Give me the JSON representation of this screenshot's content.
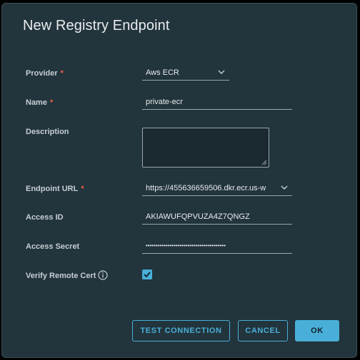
{
  "dialog": {
    "title": "New Registry Endpoint"
  },
  "form": {
    "required_marker": "*",
    "provider": {
      "label": "Provider",
      "value": "Aws ECR",
      "icon": "chevron-down-icon"
    },
    "name": {
      "label": "Name",
      "value": "private-ecr"
    },
    "description": {
      "label": "Description",
      "value": ""
    },
    "endpoint_url": {
      "label": "Endpoint URL",
      "value": "https://455636659506.dkr.ecr.us-w",
      "icon": "chevron-down-icon"
    },
    "access_id": {
      "label": "Access ID",
      "value": "AKIAWUFQPVUZA4Z7QNGZ"
    },
    "access_secret": {
      "label": "Access Secret",
      "value": "••••••••••••••••••••••••••••••••••••••••"
    },
    "verify_remote_cert": {
      "label": "Verify Remote Cert",
      "checked": true,
      "icon": "info-icon"
    }
  },
  "buttons": {
    "test_connection": "TEST CONNECTION",
    "cancel": "CANCEL",
    "ok": "OK"
  },
  "colors": {
    "background": "#22343c",
    "accent": "#49afd9",
    "required": "#f35e44",
    "text": "#e9ecef",
    "label": "#c6cfd4"
  }
}
